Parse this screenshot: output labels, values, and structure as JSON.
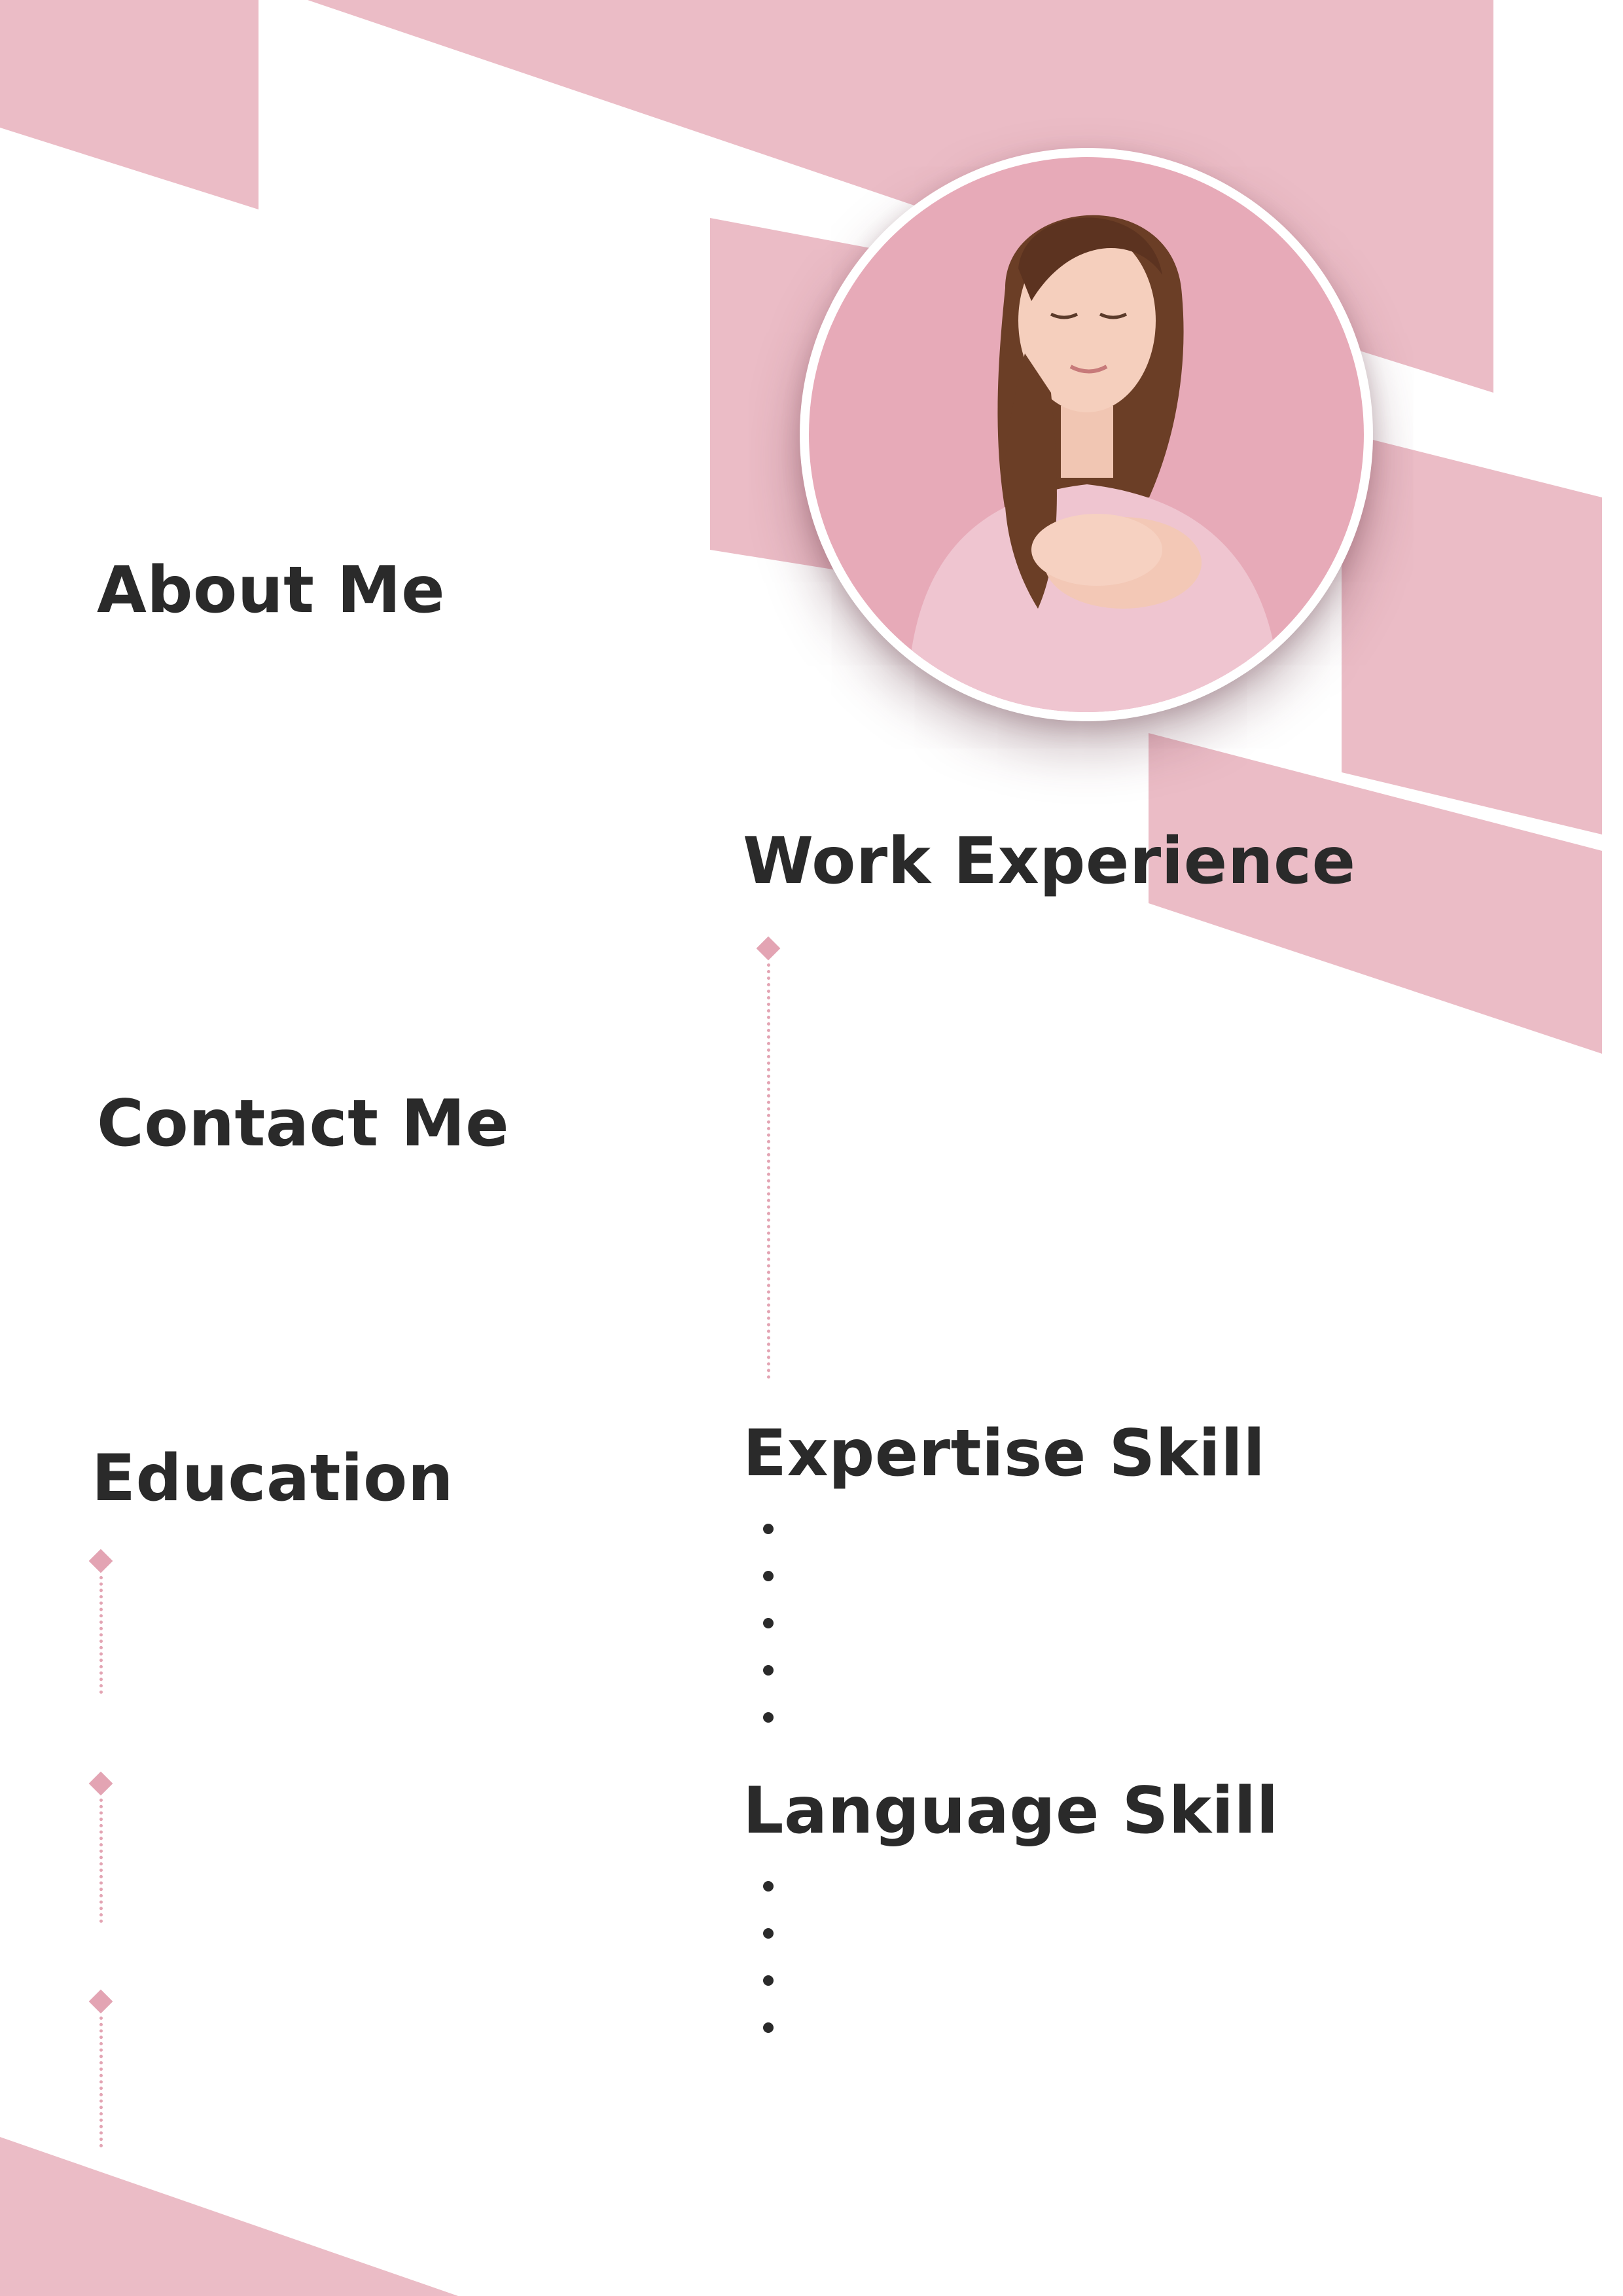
{
  "colors": {
    "accent_pink": "#ebbcc6",
    "light_pink": "#e3a4b3",
    "heading_text": "#2a2a2a",
    "background": "#ffffff"
  },
  "images": {
    "profile_photo": "profile-photo-woman"
  },
  "sections": {
    "about": {
      "title": "About Me"
    },
    "contact": {
      "title": "Contact Me"
    },
    "education": {
      "title": "Education"
    },
    "work": {
      "title": "Work Experience"
    },
    "expertise": {
      "title": "Expertise Skill"
    },
    "language": {
      "title": "Language Skill"
    }
  }
}
